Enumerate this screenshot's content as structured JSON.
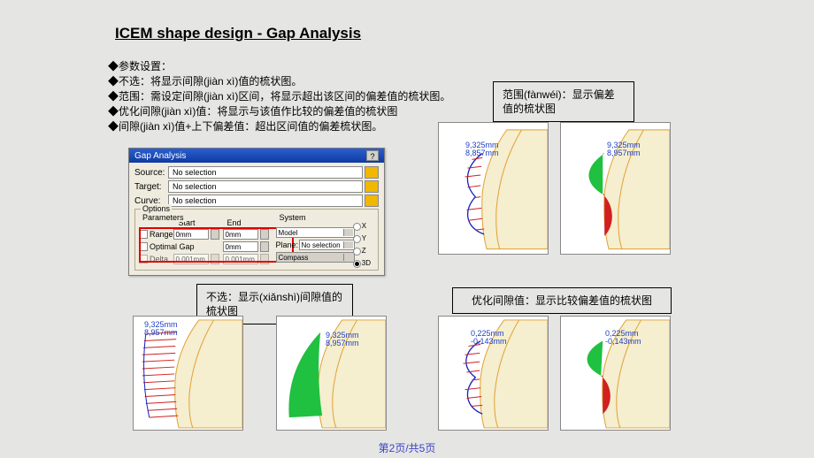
{
  "title": "ICEM shape design - Gap Analysis",
  "bullets": [
    "◆参数设置：",
    "◆不选：将显示间隙(jiàn xì)值的梳状图。",
    "◆范围：需设定间隙(jiàn xì)区间，将显示超出该区间的偏差值的梳状图。",
    "◆优化间隙(jiàn xì)值：将显示与该值作比较的偏差值的梳状图",
    "◆间隙(jiàn xì)值+上下偏差值：超出区间值的偏差梳状图。"
  ],
  "notes": {
    "top_right": "范围(fànwéi)：显示偏差值的梳状图",
    "mid_left": "不选：显示(xiǎnshì)间隙值的梳状图",
    "mid_right": "优化间隙值：显示比较偏差值的梳状图"
  },
  "dialog": {
    "title": "Gap Analysis",
    "help": "?",
    "source": "Source:",
    "target": "Target:",
    "curve": "Curve:",
    "no_selection": "No selection",
    "options": "Options",
    "parameters": "Parameters",
    "system": "System",
    "start": "Start",
    "end": "End",
    "range": "Range",
    "optimal_gap": "Optimal Gap",
    "delta": "Delta",
    "zero_mm": "0mm",
    "small_mm": "0,001mm",
    "model": "Model",
    "plane": "Plane:",
    "compass": "Compass",
    "axes": {
      "x": "X",
      "y": "Y",
      "z": "Z",
      "d3": "3D"
    }
  },
  "meas": {
    "a": "9,325mm",
    "b": "8,857mm",
    "c": "9,325mm",
    "d": "8,957mm",
    "e": "0,225mm",
    "f": "-0,143mm"
  },
  "pager": "第2页/共5页"
}
